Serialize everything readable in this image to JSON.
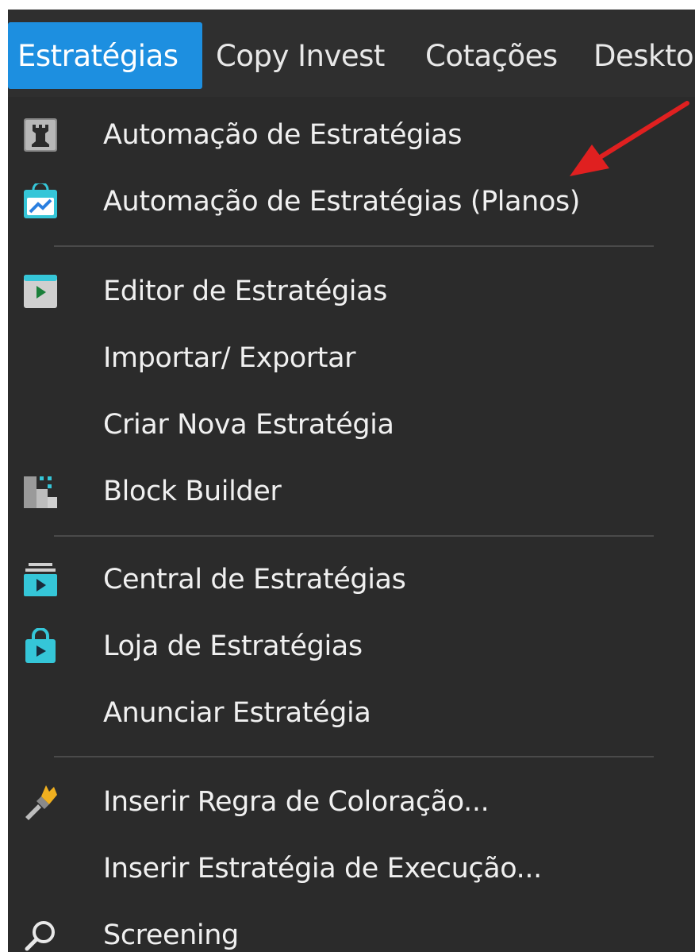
{
  "menubar": {
    "items": [
      {
        "label": "Estratégias",
        "active": true
      },
      {
        "label": "Copy Invest"
      },
      {
        "label": "Cotações"
      },
      {
        "label": "Deskto"
      }
    ]
  },
  "dropdown": {
    "items": [
      {
        "label": "Automação de Estratégias",
        "icon": "rook-icon"
      },
      {
        "label": "Automação de Estratégias (Planos)",
        "icon": "store-bag-icon"
      },
      {
        "label": "Editor de Estratégias",
        "icon": "play-box-icon"
      },
      {
        "label": "Importar/ Exportar",
        "icon": null
      },
      {
        "label": "Criar Nova Estratégia",
        "icon": null
      },
      {
        "label": "Block Builder",
        "icon": "blocks-icon"
      },
      {
        "label": "Central de Estratégias",
        "icon": "stacked-play-icon"
      },
      {
        "label": "Loja de Estratégias",
        "icon": "shopping-bag-play-icon"
      },
      {
        "label": "Anunciar Estratégia",
        "icon": null
      },
      {
        "label": "Inserir Regra de Coloração...",
        "icon": "paintbrush-icon"
      },
      {
        "label": "Inserir Estratégia de Execução...",
        "icon": null
      },
      {
        "label": "Screening",
        "icon": "search-icon"
      }
    ]
  },
  "colors": {
    "menu_bg": "#2b2b2b",
    "active_menu": "#1d8fe0",
    "text": "#f0f0f0",
    "accent_icon": "#35c6d8",
    "annotation_arrow": "#e02020"
  }
}
